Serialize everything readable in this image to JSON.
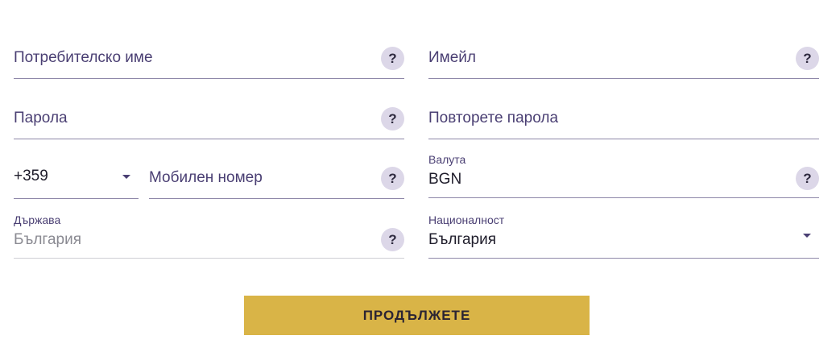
{
  "fields": {
    "username": {
      "label": "Потребителско име",
      "help": "?"
    },
    "email": {
      "label": "Имейл",
      "help": "?"
    },
    "password": {
      "label": "Парола",
      "help": "?"
    },
    "repeat_password": {
      "label": "Повторете парола"
    },
    "phone_code": {
      "value": "+359"
    },
    "mobile": {
      "label": "Мобилен номер",
      "help": "?"
    },
    "currency": {
      "label": "Валута",
      "value": "BGN",
      "help": "?"
    },
    "country": {
      "label": "Държава",
      "value": "България",
      "help": "?"
    },
    "nationality": {
      "label": "Националност",
      "value": "България"
    }
  },
  "submit_label": "ПРОДЪЛЖЕТЕ"
}
